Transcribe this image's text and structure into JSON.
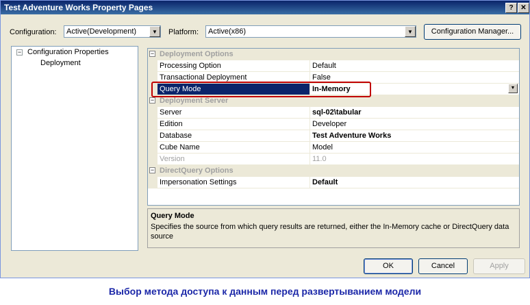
{
  "window": {
    "title": "Test Adventure Works Property Pages",
    "help_glyph": "?",
    "close_glyph": "✕"
  },
  "toolbar": {
    "configuration_label": "Configuration:",
    "configuration_value": "Active(Development)",
    "platform_label": "Platform:",
    "platform_value": "Active(x86)",
    "config_manager_label": "Configuration Manager..."
  },
  "tree": {
    "root_label": "Configuration Properties",
    "root_expander": "−",
    "child_label": "Deployment"
  },
  "grid": {
    "categories": [
      {
        "label": "Deployment Options",
        "rows": [
          {
            "name": "Processing Option",
            "value": "Default"
          },
          {
            "name": "Transactional Deployment",
            "value": "False"
          },
          {
            "name": "Query Mode",
            "value": "In-Memory"
          }
        ]
      },
      {
        "label": "Deployment Server",
        "rows": [
          {
            "name": "Server",
            "value": "sql-02\\tabular"
          },
          {
            "name": "Edition",
            "value": "Developer"
          },
          {
            "name": "Database",
            "value": "Test Adventure Works"
          },
          {
            "name": "Cube Name",
            "value": "Model"
          },
          {
            "name": "Version",
            "value": "11.0"
          }
        ]
      },
      {
        "label": "DirectQuery Options",
        "rows": [
          {
            "name": "Impersonation Settings",
            "value": "Default"
          }
        ]
      }
    ]
  },
  "description": {
    "title": "Query Mode",
    "text": "Specifies the source from which query results are returned, either the In-Memory cache or DirectQuery data source"
  },
  "buttons": {
    "ok": "OK",
    "cancel": "Cancel",
    "apply": "Apply"
  },
  "caption": "Выбор метода доступа к данным перед развертыванием модели",
  "colors": {
    "title_bar": "#0a246a",
    "selection": "#0a246a",
    "highlight_border": "#c00000",
    "caption_text": "#1b27a8"
  }
}
